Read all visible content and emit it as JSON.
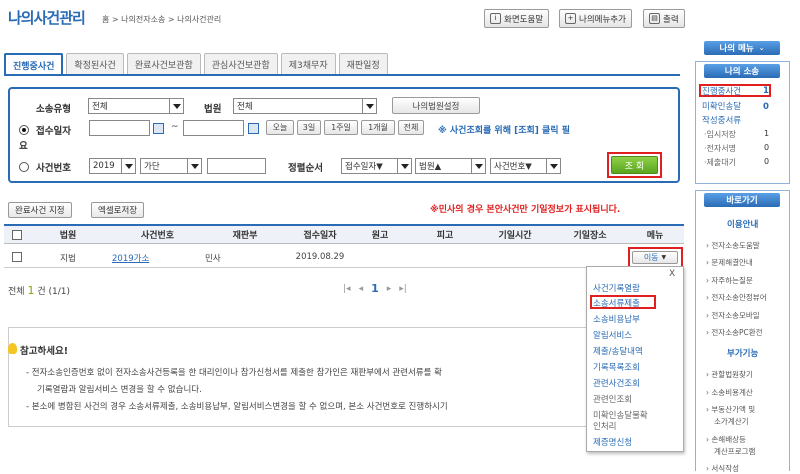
{
  "header": {
    "title": "나의사건관리",
    "breadcrumb": "홈 > 나의전자소송 > 나의사건관리",
    "buttons": {
      "help": "화면도움말",
      "add_menu": "나의메뉴추가",
      "print": "출력"
    }
  },
  "tabs": [
    "진행중사건",
    "확정된사건",
    "완료사건보관함",
    "관심사건보관함",
    "제3채무자",
    "재판일정"
  ],
  "search": {
    "type_label": "소송유형",
    "type_value": "전체",
    "court_label": "법원",
    "court_value": "전체",
    "my_court_button": "나의법원설정",
    "date_label": "접수일자",
    "date_label_tail": "요",
    "tilde": "~",
    "period_buttons": [
      "오늘",
      "3일",
      "1주일",
      "1개월",
      "전체"
    ],
    "date_note": "※ 사건조회를 위해 [조회] 클릭 필",
    "case_label": "사건번호",
    "year_value": "2019",
    "case_type_value": "가단",
    "order_label": "정렬순서",
    "order_1": "접수일자▼",
    "order_2": "법원▲",
    "order_3": "사건번호▼",
    "query_button": "조 회"
  },
  "actions": {
    "complete_button": "완료사건 지정",
    "excel_button": "엑셀로저장",
    "warning": "※민사의 경우 본안사건만 기일정보가 표시됩니다."
  },
  "table": {
    "headers": [
      "법원",
      "사건번호",
      "재판부",
      "접수일자",
      "원고",
      "피고",
      "기일시간",
      "기일장소",
      "메뉴"
    ],
    "row": {
      "court": "지법",
      "case_no": "2019가소",
      "division": "민사",
      "date": "2019.08.29",
      "menu": "이동"
    }
  },
  "footer": {
    "total_prefix": "전체",
    "total_count": "1",
    "total_suffix": "건 (1/1)",
    "page": "1"
  },
  "notice": {
    "title": "참고하세요!",
    "line1": "- 전자소송인증번호 없이 전자소송사건등록을 한 대리인이나 참가신청서를 제출한 참가인은 재판부에서 관련서류를 확",
    "line2": "기록열람과 알림서비스 변경을 할 수 없습니다.",
    "line3": "- 본소에 병합된 사건의 경우 소송서류제출, 소송비용납부, 알림서비스변경을 할 수 없으며, 본소 사건번호로 진행하시기"
  },
  "popup": {
    "close": "X",
    "items": [
      "사건기록열람",
      "소송서류제출",
      "소송비용납부",
      "알림서비스",
      "제출/송달내역",
      "기록목록조회",
      "관련사건조회",
      "관련인조회",
      "미확인송달물확",
      "인처리",
      "제증명신청"
    ]
  },
  "sidebar": {
    "my_menu": "나의 메뉴",
    "my_lawsuit": "나의 소송",
    "ongoing_label": "진행중사건",
    "ongoing_count": "1",
    "unconfirmed_label": "미확인송달",
    "unconfirmed_count": "0",
    "writing_label": "작성중서류",
    "temp_label": "·임시저장",
    "temp_count": "1",
    "sign_label": "·전자서명",
    "sign_count": "0",
    "wait_label": "·제출대기",
    "wait_count": "0",
    "shortcut": "바로가기",
    "guide_head": "이용안내",
    "guide_links": [
      "전자소송도움말",
      "문제해결안내",
      "자주하는질문",
      "전자소송안정뷰어",
      "전자소송모바일",
      "전자소송PC환전"
    ],
    "extra_head": "부가기능",
    "extra_links": [
      "관할법원찾기",
      "소송비용계산",
      "부동산가액 및",
      "소가계산기",
      "손해배상등",
      "계산프로그램",
      "서식작성"
    ]
  }
}
